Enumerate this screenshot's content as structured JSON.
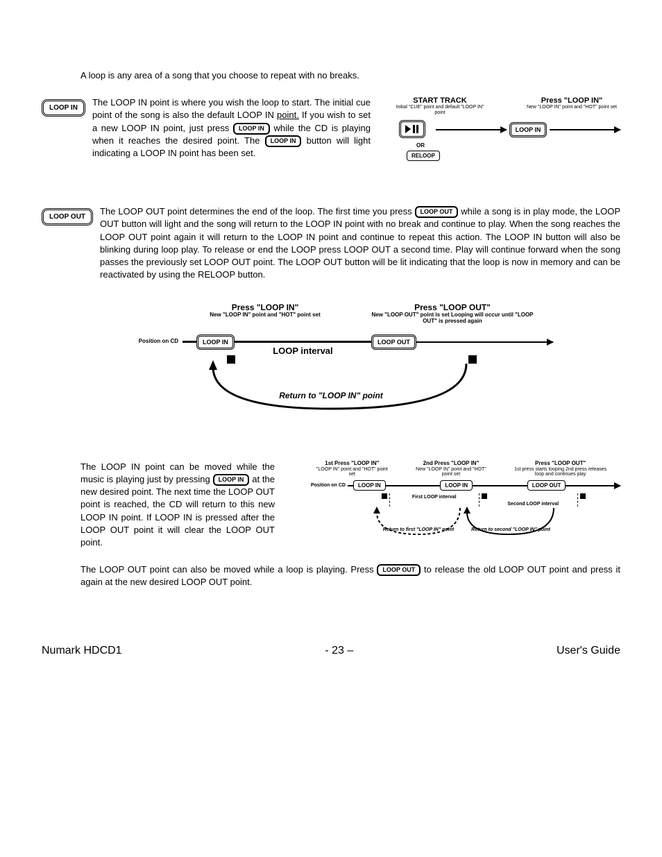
{
  "intro": "A loop is any area of a song that you choose to repeat with no breaks.",
  "buttons": {
    "loop_in": "LOOP IN",
    "loop_out": "LOOP OUT",
    "reloop": "RELOOP",
    "or": "OR"
  },
  "para_loop_in": {
    "pre": "The LOOP IN point is where you wish the loop to start.  The initial cue point of the song is also the default LOOP IN ",
    "underlined": "point.",
    "mid1": "  If you wish to set a new LOOP IN point, just press ",
    "mid2": " while the CD is playing when it reaches the desired point.  The ",
    "post": " button will light indicating a LOOP IN point has been set."
  },
  "diagram1": {
    "left_title": "START TRACK",
    "left_sub": "Initial \"CUE\" point and default \"LOOP IN\" point",
    "right_title": "Press \"LOOP IN\"",
    "right_sub": "New \"LOOP IN\" point and \"HOT\" point set"
  },
  "para_loop_out": {
    "pre": "The LOOP OUT point determines the end of the loop.  The first time you press ",
    "post": " while a song is in play mode, the LOOP OUT button will light and the song will return to the LOOP IN point with no break and continue to play.  When the song reaches the LOOP OUT point again it will return to the LOOP IN point and continue to repeat this action.  The LOOP IN button will also be blinking during loop play.   To release or end the LOOP press LOOP OUT a second time.  Play will continue forward when the song passes the previously set LOOP OUT point.  The LOOP OUT button will be lit indicating that the loop is now in memory and can be reactivated by using the RELOOP button."
  },
  "diagram2": {
    "left_title": "Press \"LOOP IN\"",
    "left_sub": "New \"LOOP IN\" point and \"HOT\" point set",
    "right_title": "Press \"LOOP OUT\"",
    "right_sub": "New \"LOOP OUT\" point is set Looping will occur until \"LOOP OUT\" is pressed again",
    "pos_label": "Position on CD",
    "interval": "LOOP interval",
    "return": "Return to \"LOOP IN\" point"
  },
  "para_move_in": {
    "pre": "The LOOP IN point can be moved while the music is playing just by pressing ",
    "post": " at the new desired point.   The next time the LOOP OUT point is reached, the CD will return to this new LOOP IN point.   If LOOP IN is pressed after the LOOP OUT point it will clear the LOOP OUT point."
  },
  "diagram3": {
    "col1_title": "1st Press \"LOOP IN\"",
    "col1_sub": "\"LOOP IN\" point and \"HOT\" point set",
    "col2_title": "2nd Press \"LOOP IN\"",
    "col2_sub": "New \"LOOP IN\" point and \"HOT\" point set",
    "col3_title": "Press \"LOOP OUT\"",
    "col3_sub": "1st press starts looping 2nd press releases loop and continues play",
    "pos_label": "Position on CD",
    "first_int": "First LOOP interval",
    "second_int": "Second LOOP interval",
    "return1": "Return to first \"LOOP IN\" point",
    "return2": "Return to second \"LOOP IN\" point"
  },
  "para_move_out": {
    "pre": "The LOOP OUT point can also be moved while a loop is playing.  Press ",
    "post": " to release the old LOOP OUT point and press it again at the new desired LOOP OUT point."
  },
  "footer": {
    "left": "Numark HDCD1",
    "center": "- 23 –",
    "right": "User's Guide"
  }
}
